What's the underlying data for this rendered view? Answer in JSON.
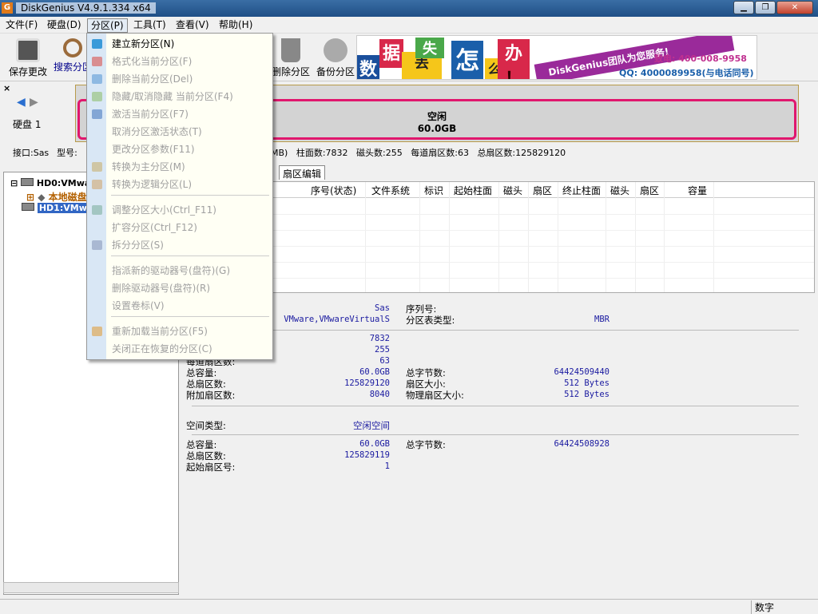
{
  "window": {
    "title": "DiskGenius V4.9.1.334 x64",
    "logo": "G"
  },
  "menubar": [
    "文件(F)",
    "硬盘(D)",
    "分区(P)",
    "工具(T)",
    "查看(V)",
    "帮助(H)"
  ],
  "toolbar": {
    "buttons": [
      {
        "label": "保存更改",
        "icon": "save-icon"
      },
      {
        "label": "搜索分区",
        "icon": "search-icon"
      },
      {
        "label": "删除分区",
        "icon": "trash-icon"
      },
      {
        "label": "备份分区",
        "icon": "backup-icon"
      }
    ]
  },
  "banner": {
    "chars": [
      "数",
      "据",
      "丢",
      "失",
      "怎",
      "么",
      "办",
      "！"
    ],
    "slogan": "DiskGenius团队为您服务!",
    "phone": "致电: 400-008-9958",
    "qq": "QQ: 4000089958(与电话同号)"
  },
  "disk_nav": {
    "label": "硬盘 1",
    "close": "×"
  },
  "disk_bar": {
    "label": "空闲",
    "size": "60.0GB"
  },
  "disk_info": {
    "interface": "接口:Sas",
    "model": "型号:",
    "capacity_tail": "0MB)",
    "cylinders": "柱面数:7832",
    "heads": "磁头数:255",
    "sectors_per_track": "每道扇区数:63",
    "total_sectors": "总扇区数:125829120"
  },
  "tree": {
    "nodes": [
      "HD0:VMware",
      "本地磁盘",
      "HD1:VMware"
    ]
  },
  "tabs": [
    "扇区编辑"
  ],
  "grid": {
    "columns": [
      "序号(状态)",
      "文件系统",
      "标识",
      "起始柱面",
      "磁头",
      "扇区",
      "终止柱面",
      "磁头",
      "扇区",
      "容量"
    ]
  },
  "details": {
    "interface_val": "Sas",
    "model_val": "VMware,VMwareVirtualS",
    "serial_label": "序列号:",
    "ptable_label": "分区表类型:",
    "ptable_val": "MBR",
    "cyl_val": "7832",
    "heads_val": "255",
    "spt_label": "每道扇区数:",
    "spt_val": "63",
    "cap_label": "总容量:",
    "cap_val": "60.0GB",
    "bytes_label": "总字节数:",
    "bytes_val": "64424509440",
    "sectors_label": "总扇区数:",
    "sectors_val": "125829120",
    "secsize_label": "扇区大小:",
    "secsize_val": "512 Bytes",
    "extra_label": "附加扇区数:",
    "extra_val": "8040",
    "phys_label": "物理扇区大小:",
    "phys_val": "512 Bytes",
    "space_label": "空间类型:",
    "space_val": "空闲空间",
    "fcap_label": "总容量:",
    "fcap_val": "60.0GB",
    "fbytes_label": "总字节数:",
    "fbytes_val": "64424508928",
    "fsec_label": "总扇区数:",
    "fsec_val": "125829119",
    "fstart_label": "起始扇区号:",
    "fstart_val": "1"
  },
  "dropdown": {
    "items": [
      {
        "label": "建立新分区(N)",
        "enabled": true,
        "color": "#3a9ad9"
      },
      {
        "label": "格式化当前分区(F)",
        "enabled": false,
        "color": "#d9534f"
      },
      {
        "label": "删除当前分区(Del)",
        "enabled": false,
        "color": "#5b9bd5"
      },
      {
        "label": "隐藏/取消隐藏 当前分区(F4)",
        "enabled": false,
        "color": "#8fbf6f"
      },
      {
        "label": "激活当前分区(F7)",
        "enabled": false,
        "color": "#4a7cc0"
      },
      {
        "label": "取消分区激活状态(T)",
        "enabled": false
      },
      {
        "label": "更改分区参数(F11)",
        "enabled": false
      },
      {
        "label": "转换为主分区(M)",
        "enabled": false,
        "color": "#c8b070"
      },
      {
        "label": "转换为逻辑分区(L)",
        "enabled": false,
        "color": "#d0a870"
      },
      {
        "label": "调整分区大小(Ctrl_F11)",
        "enabled": false,
        "color": "#7fb0a0"
      },
      {
        "label": "扩容分区(Ctrl_F12)",
        "enabled": false
      },
      {
        "label": "拆分分区(S)",
        "enabled": false,
        "color": "#8899bb"
      },
      {
        "label": "指派新的驱动器号(盘符)(G)",
        "enabled": false
      },
      {
        "label": "删除驱动器号(盘符)(R)",
        "enabled": false
      },
      {
        "label": "设置卷标(V)",
        "enabled": false
      },
      {
        "label": "重新加载当前分区(F5)",
        "enabled": false,
        "color": "#e0a040"
      },
      {
        "label": "关闭正在恢复的分区(C)",
        "enabled": false
      }
    ]
  },
  "statusbar": {
    "numlock": "数字"
  }
}
